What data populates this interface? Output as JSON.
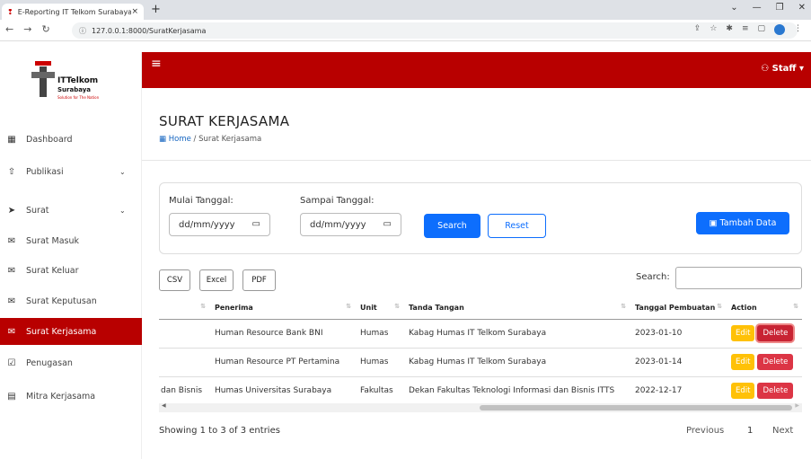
{
  "browser": {
    "tab_title": "E-Reporting IT Telkom Surabaya",
    "tab_close": "×",
    "new_tab": "+",
    "url": "127.0.0.1:8000/SuratKerjasama"
  },
  "brand": {
    "name": "ITTelkom",
    "city": "Surabaya",
    "tagline": "Solution for The Nation",
    "color": "#b80000"
  },
  "sidebar": {
    "items": [
      {
        "label": "Dashboard",
        "icon": "grid-icon"
      },
      {
        "label": "Publikasi",
        "icon": "upload-icon",
        "has_submenu": true
      },
      {
        "label": "Surat",
        "icon": "send-icon",
        "has_submenu": true
      },
      {
        "label": "Surat Masuk",
        "icon": "mail-icon"
      },
      {
        "label": "Surat Keluar",
        "icon": "mail-out-icon"
      },
      {
        "label": "Surat Keputusan",
        "icon": "mail-open-icon"
      },
      {
        "label": "Surat Kerjasama",
        "icon": "mail-icon",
        "active": true
      },
      {
        "label": "Penugasan",
        "icon": "clipboard-icon"
      },
      {
        "label": "Mitra Kerjasama",
        "icon": "id-card-icon"
      }
    ]
  },
  "topbar": {
    "user_label": "Staff"
  },
  "page": {
    "title": "SURAT KERJASAMA",
    "breadcrumb_home": "Home",
    "breadcrumb_current": "/ Surat Kerjasama"
  },
  "filter": {
    "start_label": "Mulai Tanggal:",
    "end_label": "Sampai Tanggal:",
    "start_placeholder": "dd/mm/yyyy",
    "end_placeholder": "dd/mm/yyyy",
    "search_button": "Search",
    "reset_button": "Reset",
    "add_button": "Tambah Data"
  },
  "export": {
    "csv": "CSV",
    "excel": "Excel",
    "pdf": "PDF",
    "search_label": "Search:"
  },
  "table": {
    "headers": [
      "",
      "Penerima",
      "Unit",
      "Tanda Tangan",
      "Tanggal Pembuatan",
      "Action"
    ],
    "rows": [
      {
        "c0": "",
        "penerima": "Human Resource Bank BNI",
        "unit": "Humas",
        "ttd": "Kabag Humas IT Telkom Surabaya",
        "tanggal": "2023-01-10"
      },
      {
        "c0": "",
        "penerima": "Human Resource PT Pertamina",
        "unit": "Humas",
        "ttd": "Kabag Humas IT Telkom Surabaya",
        "tanggal": "2023-01-14"
      },
      {
        "c0": "dan Bisnis",
        "penerima": "Humas Universitas Surabaya",
        "unit": "Fakultas",
        "ttd": "Dekan Fakultas Teknologi Informasi dan Bisnis ITTS",
        "tanggal": "2022-12-17"
      }
    ],
    "edit_label": "Edit",
    "delete_label": "Delete"
  },
  "footer": {
    "showing": "Showing 1 to 3 of 3 entries",
    "previous": "Previous",
    "page": "1",
    "next": "Next"
  }
}
